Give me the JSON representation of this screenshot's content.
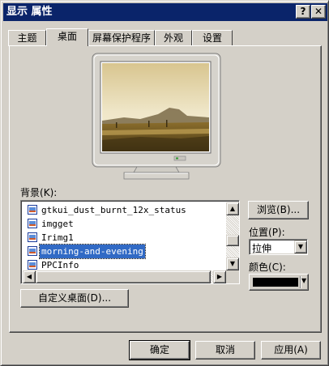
{
  "window": {
    "title": "显示 属性",
    "help_label": "?",
    "close_label": "✕"
  },
  "tabs": [
    {
      "label": "主题"
    },
    {
      "label": "桌面"
    },
    {
      "label": "屏幕保护程序"
    },
    {
      "label": "外观"
    },
    {
      "label": "设置"
    }
  ],
  "background": {
    "label": "背景",
    "hotkey": "(K):",
    "items": [
      {
        "name": "gtkui_dust_burnt_12x_status"
      },
      {
        "name": "imgget"
      },
      {
        "name": "Irimg1"
      },
      {
        "name": "morning-and-evening"
      },
      {
        "name": "PPCInfo"
      }
    ],
    "selected": "morning-and-evening"
  },
  "browse_button": "浏览(B)...",
  "position": {
    "label": "位置",
    "hotkey": "(P):",
    "value": "拉伸"
  },
  "color": {
    "label": "颜色",
    "hotkey": "(C):",
    "value": "#000000"
  },
  "customize_button": "自定义桌面(D)...",
  "footer": {
    "ok": "确定",
    "cancel": "取消",
    "apply": "应用(A)"
  }
}
